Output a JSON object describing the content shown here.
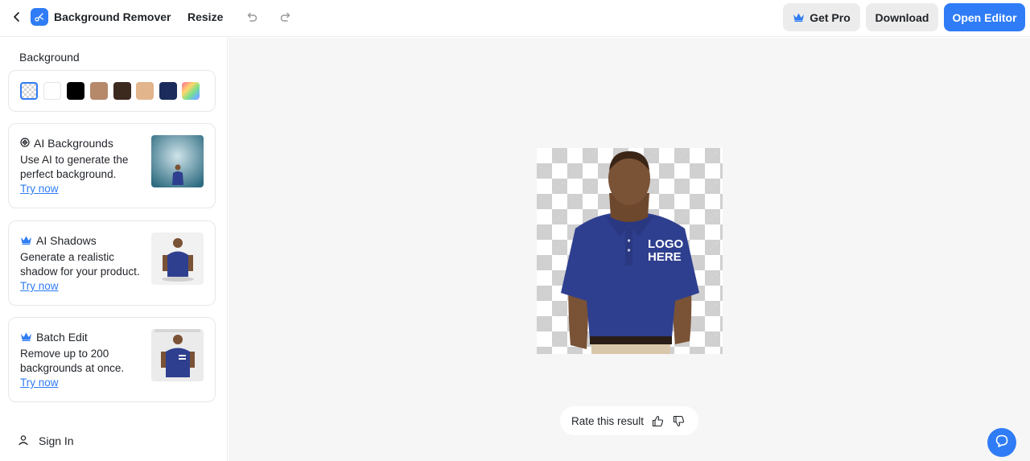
{
  "header": {
    "app_title": "Background Remover",
    "resize_label": "Resize",
    "get_pro_label": "Get Pro",
    "download_label": "Download",
    "open_editor_label": "Open Editor"
  },
  "sidebar": {
    "background_heading": "Background",
    "swatches": [
      {
        "name": "transparent",
        "color": "transparent",
        "selected": true
      },
      {
        "name": "white",
        "color": "#ffffff"
      },
      {
        "name": "black",
        "color": "#000000"
      },
      {
        "name": "tan",
        "color": "#b5896a"
      },
      {
        "name": "dark-brown",
        "color": "#3d2a1f"
      },
      {
        "name": "beige",
        "color": "#e2b58c"
      },
      {
        "name": "navy",
        "color": "#1b2c5c"
      },
      {
        "name": "rainbow",
        "color": "gradient"
      }
    ],
    "cards": [
      {
        "title": "AI Backgrounds",
        "desc": "Use AI to generate the perfect background.",
        "link": "Try now",
        "icon": "ai-sparkle-icon"
      },
      {
        "title": "AI Shadows",
        "desc": "Generate a realistic shadow for your product.",
        "link": "Try now",
        "icon": "crown-icon"
      },
      {
        "title": "Batch Edit",
        "desc": "Remove up to 200 backgrounds at once.",
        "link": "Try now",
        "icon": "crown-icon"
      }
    ],
    "sign_in_label": "Sign In"
  },
  "canvas": {
    "shirt_logo_line1": "LOGO",
    "shirt_logo_line2": "HERE",
    "rate_label": "Rate this result"
  },
  "colors": {
    "accent": "#2f7cf6",
    "shirt": "#2f3f8f"
  }
}
